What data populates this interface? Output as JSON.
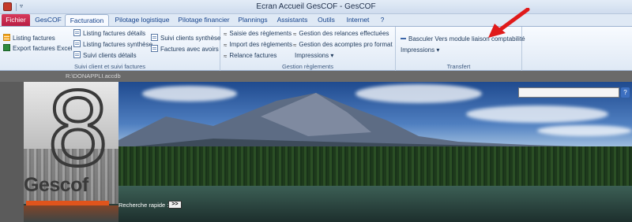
{
  "window": {
    "title": "Ecran Accueil GesCOF  -  GesCOF",
    "qat_dropdown": "▿"
  },
  "tabs": [
    {
      "label": "Fichier"
    },
    {
      "label": "GesCOF"
    },
    {
      "label": "Facturation"
    },
    {
      "label": "Pilotage logistique"
    },
    {
      "label": "Pilotage financier"
    },
    {
      "label": "Plannings"
    },
    {
      "label": "Assistants"
    },
    {
      "label": "Outils"
    },
    {
      "label": "Internet"
    },
    {
      "label": "?"
    }
  ],
  "ribbon": {
    "group1": {
      "label": "Suivi client et suivi factures",
      "items": [
        {
          "label": "Listing factures"
        },
        {
          "label": "Export factures Excel"
        },
        {
          "label": "Listing factures détails"
        },
        {
          "label": "Listing factures synthèse"
        },
        {
          "label": "Suivi clients détails"
        },
        {
          "label": "Suivi clients synthèse"
        },
        {
          "label": "Factures avec avoirs"
        }
      ]
    },
    "group2": {
      "label": "Gestion règlements",
      "items": [
        {
          "label": "Saisie des règlements"
        },
        {
          "label": "Import des règlements"
        },
        {
          "label": "Relance factures"
        },
        {
          "label": "Gestion des relances effectuées"
        },
        {
          "label": "Gestion des acomptes pro format"
        },
        {
          "label": "Impressions"
        }
      ]
    },
    "group3": {
      "label": "Transfert",
      "items": [
        {
          "label": "Basculer Vers module liaison comptabilité"
        },
        {
          "label": "Impressions"
        }
      ]
    }
  },
  "workspace": {
    "db_path": "R:\\DONAPPLI.accdb",
    "logo_digit": "8",
    "logo_name": "Gescof",
    "quick_search_label": "Recherche rapide :",
    "quick_search_button": ">>",
    "search_button": "?"
  }
}
